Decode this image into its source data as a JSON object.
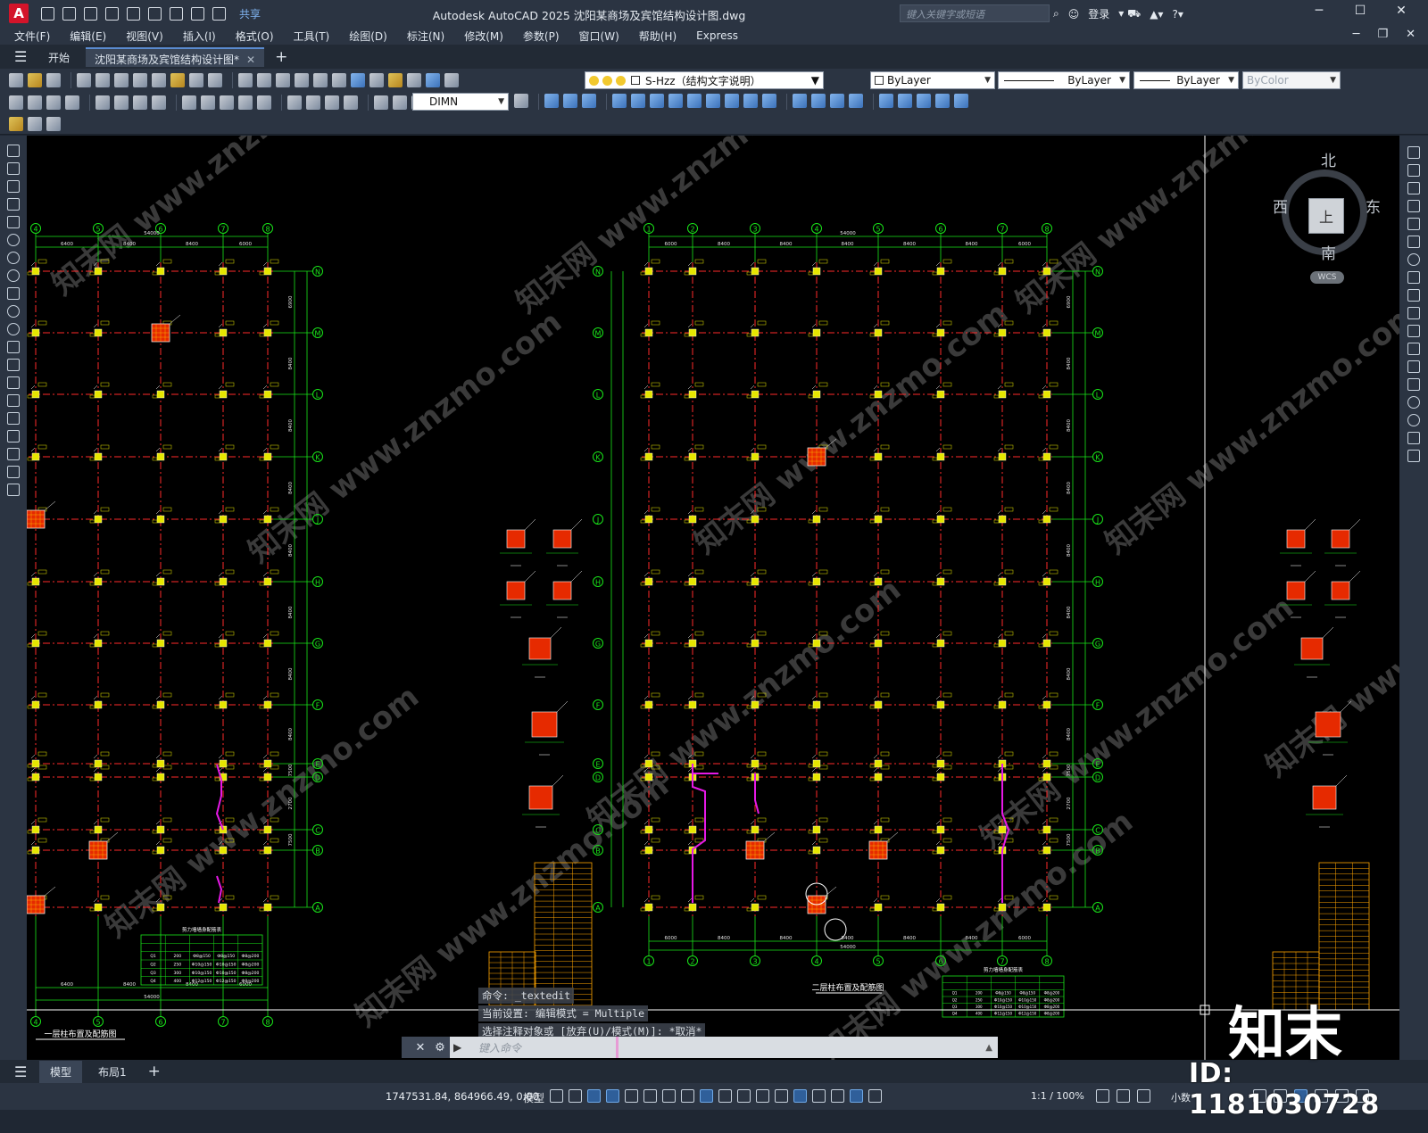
{
  "app": {
    "logo_letter": "A",
    "share_label": "共享",
    "window_title": "Autodesk AutoCAD 2025    沈阳某商场及宾馆结构设计图.dwg",
    "search_placeholder": "键入关键字或短语",
    "login_label": "登录"
  },
  "menu": [
    "文件(F)",
    "编辑(E)",
    "视图(V)",
    "插入(I)",
    "格式(O)",
    "工具(T)",
    "绘图(D)",
    "标注(N)",
    "修改(M)",
    "参数(P)",
    "窗口(W)",
    "帮助(H)",
    "Express"
  ],
  "tabs": {
    "start": "开始",
    "active": "沈阳某商场及宾馆结构设计图*"
  },
  "toolbar": {
    "layer": "S-Hzz（结构文字说明）",
    "color": "ByLayer",
    "linetype": "ByLayer",
    "lineweight": "ByLayer",
    "plotstyle": "ByColor",
    "dimstyle": "DIMN"
  },
  "viewcube": {
    "north": "北",
    "south": "南",
    "east": "东",
    "west": "西",
    "face": "上",
    "wcs": "WCS"
  },
  "command": {
    "history": [
      "命令:  _textedit",
      "当前设置: 编辑模式 = Multiple",
      "选择注释对象或 [放弃(U)/模式(M)]: *取消*"
    ],
    "placeholder": "键入命令",
    "prompt_icon": "▶"
  },
  "layouts": {
    "model": "模型",
    "layout1": "布局1"
  },
  "status": {
    "coords": "1747531.84, 864966.49, 0.00",
    "mode": "模型",
    "scale": "1:1 / 100%",
    "units": "小数"
  },
  "drawing": {
    "left_title": "一层柱布置及配筋图",
    "right_title": "二层柱布置及配筋图",
    "table_title": "剪力墙墙身配筋表",
    "left_col_labels": [
      "4",
      "5",
      "6",
      "7",
      "8"
    ],
    "right_col_labels": [
      "1",
      "2",
      "3",
      "4",
      "5",
      "6",
      "7",
      "8"
    ],
    "row_labels": [
      "N",
      "M",
      "L",
      "K",
      "J",
      "H",
      "G",
      "F",
      "E",
      "D",
      "C",
      "B",
      "A"
    ],
    "left_dims": [
      "6400",
      "8400",
      "8400",
      "6000"
    ],
    "left_total": "54000",
    "right_dims": [
      "6000",
      "8400",
      "8400",
      "8400",
      "8400",
      "8400",
      "6000"
    ],
    "right_total": "54000",
    "row_dims": [
      "6900",
      "8400",
      "8400",
      "8400",
      "8400",
      "8400",
      "8400",
      "8400",
      "7500",
      "2700",
      "7500"
    ],
    "table_rows": [
      [
        "Q1",
        "200",
        "Ф8@150",
        "Ф8@150",
        "Ф8@200"
      ],
      [
        "Q2",
        "250",
        "Ф10@150",
        "Ф10@150",
        "Ф8@200"
      ],
      [
        "Q3",
        "300",
        "Ф10@150",
        "Ф10@150",
        "Ф8@200"
      ],
      [
        "Q4",
        "400",
        "Ф12@150",
        "Ф12@150",
        "Ф8@200"
      ]
    ]
  },
  "watermark": {
    "site": "知末网 www.znzmo.com",
    "logo": "知末",
    "id": "ID: 1181030728"
  },
  "colors": {
    "grid_line": "#ff2a2a",
    "axis_green": "#19e619",
    "column_fill": "#e62a00",
    "column_tag": "#e6e600",
    "wall": "#e619e6"
  }
}
